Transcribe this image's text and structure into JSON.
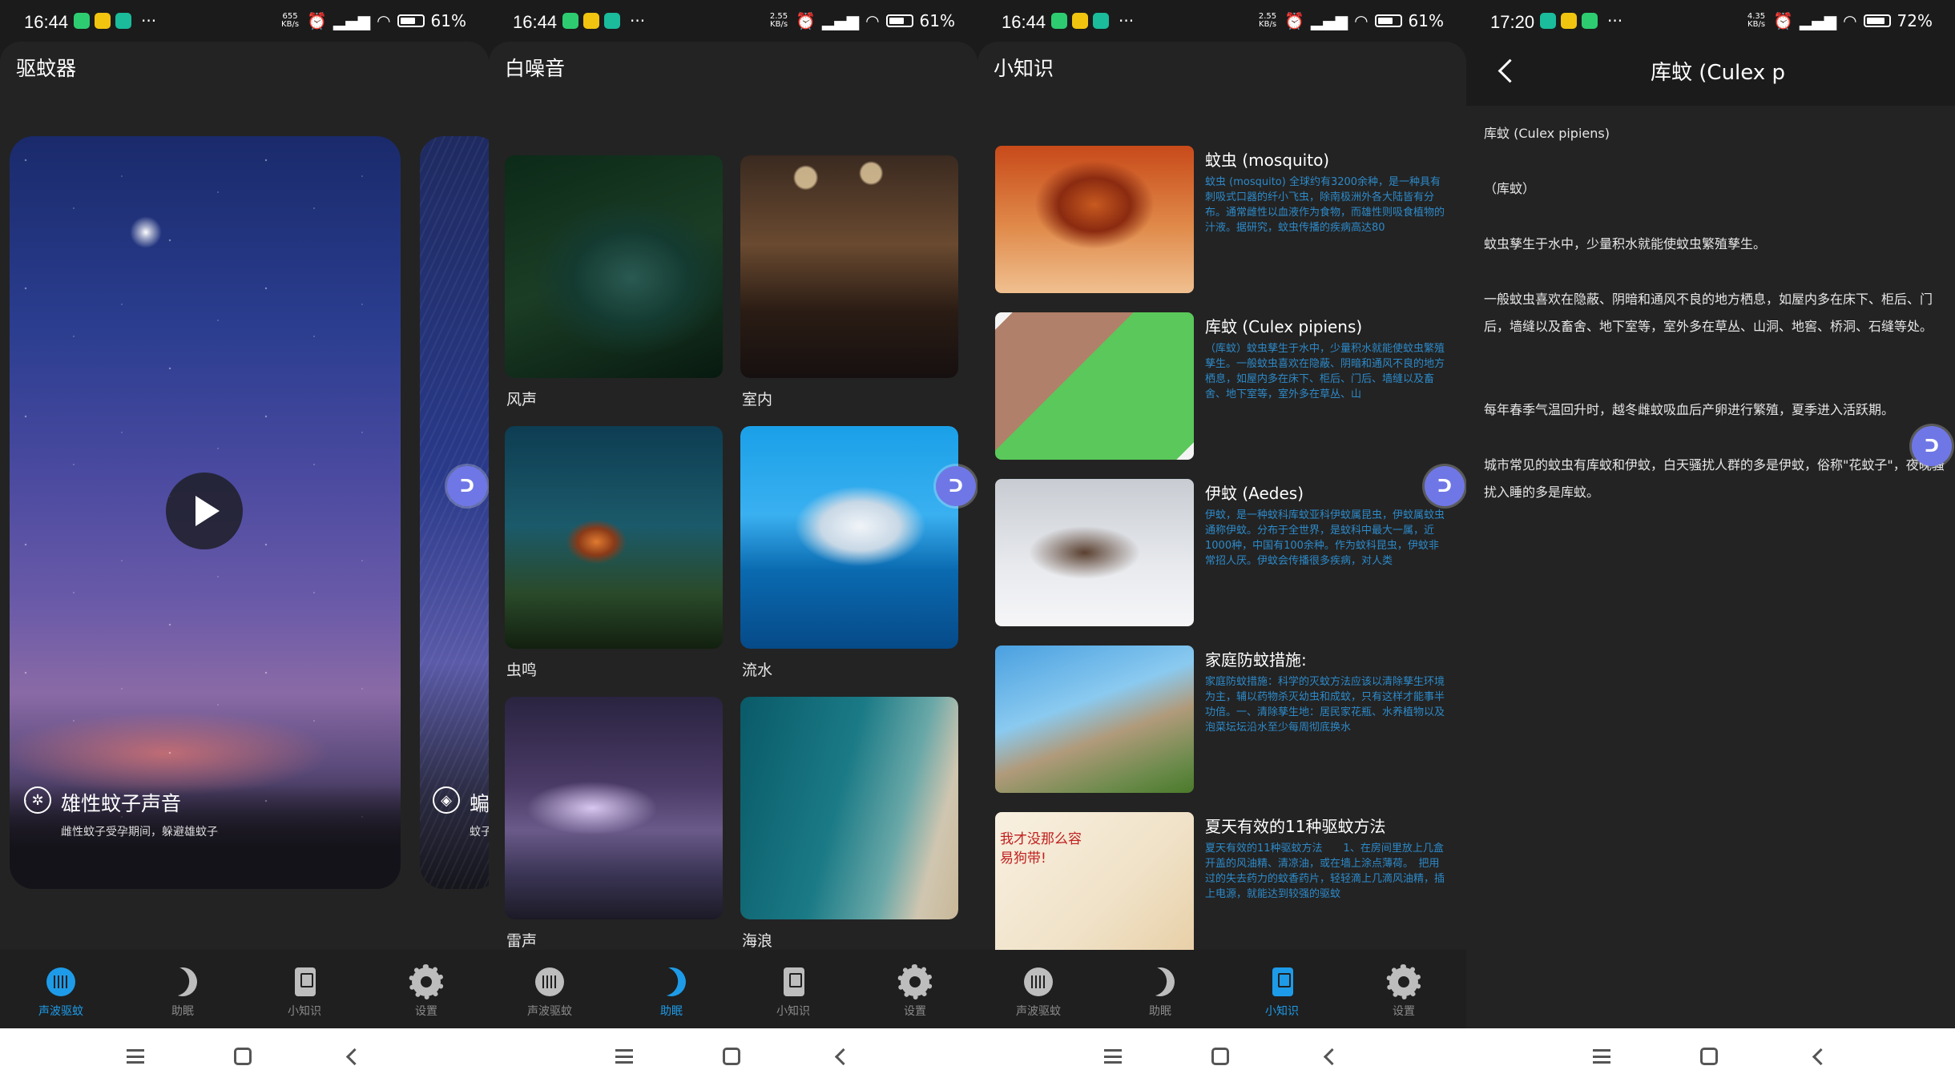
{
  "status_bars": [
    {
      "time": "16:44",
      "speed": "655 KB/s",
      "battery": "61%",
      "battery_level": 0.61
    },
    {
      "time": "16:44",
      "speed": "2.55 KB/s",
      "battery": "61%",
      "battery_level": 0.61
    },
    {
      "time": "16:44",
      "speed": "2.55 KB/s",
      "battery": "61%",
      "battery_level": 0.61
    },
    {
      "time": "17:20",
      "speed": "4.35 KB/s",
      "battery": "72%",
      "battery_level": 0.72
    }
  ],
  "status_dots": "···",
  "screen1": {
    "title": "驱蚊器",
    "card": {
      "label": "雄性蚊子声音",
      "subtitle": "雌性蚊子受孕期间，躲避雄蚊子"
    },
    "peek_card": {
      "label": "蝙",
      "subtitle": "蚊子"
    }
  },
  "screen2": {
    "title": "白噪音",
    "tiles": [
      {
        "label": "风声"
      },
      {
        "label": "室内"
      },
      {
        "label": "虫鸣"
      },
      {
        "label": "流水"
      },
      {
        "label": "雷声"
      },
      {
        "label": "海浪"
      }
    ]
  },
  "screen3": {
    "title": "小知识",
    "articles": [
      {
        "title": "蚊虫 (mosquito)",
        "summary": "蚊虫 (mosquito) 全球约有3200余种，是一种具有刺吸式口器的纤小飞虫，除南极洲外各大陆皆有分布。通常雌性以血液作为食物，而雄性则吸食植物的汁液。据研究，蚊虫传播的疾病高达80"
      },
      {
        "title": "库蚊 (Culex pipiens)",
        "summary": "（库蚊）蚊虫孳生于水中，少量积水就能使蚊虫繁殖孳生。一般蚊虫喜欢在隐蔽、阴暗和通风不良的地方栖息，如屋内多在床下、柜后、门后、墙缝以及畜舍、地下室等，室外多在草丛、山"
      },
      {
        "title": "伊蚊 (Aedes)",
        "summary": "伊蚊，是一种蚊科库蚊亚科伊蚊属昆虫，伊蚊属蚊虫通称伊蚊。分布于全世界，是蚊科中最大一属，近1000种，中国有100余种。作为蚊科昆虫，伊蚊非常招人厌。伊蚊会传播很多疾病，对人类"
      },
      {
        "title": "家庭防蚊措施:",
        "summary": "家庭防蚊措施：科学的灭蚊方法应该以清除孳生环境为主，辅以药物杀灭幼虫和成蚊，只有这样才能事半功倍。一、清除孳生地：居民家花瓶、水养植物以及泡菜坛坛沿水至少每周彻底换水"
      },
      {
        "title": "夏天有效的11种驱蚊方法",
        "summary": "夏天有效的11种驱蚊方法　　1、在房间里放上几盒开盖的风油精、清凉油，或在墙上涂点薄荷。　把用过的失去药力的蚊香药片，轻轻滴上几滴风油精，插上电源，就能达到较强的驱蚊",
        "image_text": "我才没那么容易狗带!"
      }
    ]
  },
  "screen4": {
    "title": "库蚊 (Culex p",
    "paragraphs": [
      "库蚊 (Culex pipiens)",
      "（库蚊）",
      "蚊虫孳生于水中，少量积水就能使蚊虫繁殖孳生。",
      "一般蚊虫喜欢在隐蔽、阴暗和通风不良的地方栖息，如屋内多在床下、柜后、门后，墙缝以及畜舍、地下室等，室外多在草丛、山洞、地窖、桥洞、石缝等处。",
      "每年春季气温回升时，越冬雌蚊吸血后产卵进行繁殖，夏季进入活跃期。",
      "城市常见的蚊虫有库蚊和伊蚊，白天骚扰人群的多是伊蚊，俗称\"花蚊子\"，夜晚骚扰入睡的多是库蚊。"
    ]
  },
  "nav": {
    "items": [
      {
        "label": "声波驱蚊",
        "icon": "sound-wave-icon"
      },
      {
        "label": "助眠",
        "icon": "moon-icon"
      },
      {
        "label": "小知识",
        "icon": "book-icon"
      },
      {
        "label": "设置",
        "icon": "gear-icon"
      }
    ],
    "active": [
      0,
      1,
      2
    ]
  },
  "colors": {
    "accent": "#1e9be8",
    "link_text": "#2d8ac9",
    "float_button": "#6f77e6",
    "background": "#232323"
  }
}
